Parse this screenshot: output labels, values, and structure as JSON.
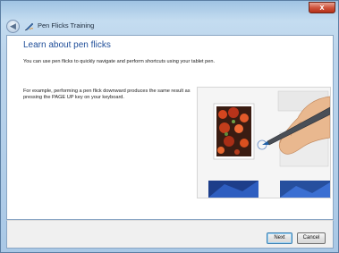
{
  "window": {
    "close_glyph": "x",
    "title": "Pen Flicks Training",
    "back_icon": "back-arrow-icon",
    "app_icon": "pen-flicks-icon"
  },
  "main": {
    "heading": "Learn about pen flicks",
    "intro": "You can use pen flicks to quickly navigate and perform shortcuts using your tablet pen.",
    "example": "For example, performing a pen flick downward produces the same result as pressing the PAGE UP key on your keyboard."
  },
  "footer": {
    "next_label": "Next",
    "cancel_label": "Cancel"
  },
  "colors": {
    "heading": "#1f4e99",
    "frame": "#a9c8e6",
    "close_button": "#c8402a"
  }
}
